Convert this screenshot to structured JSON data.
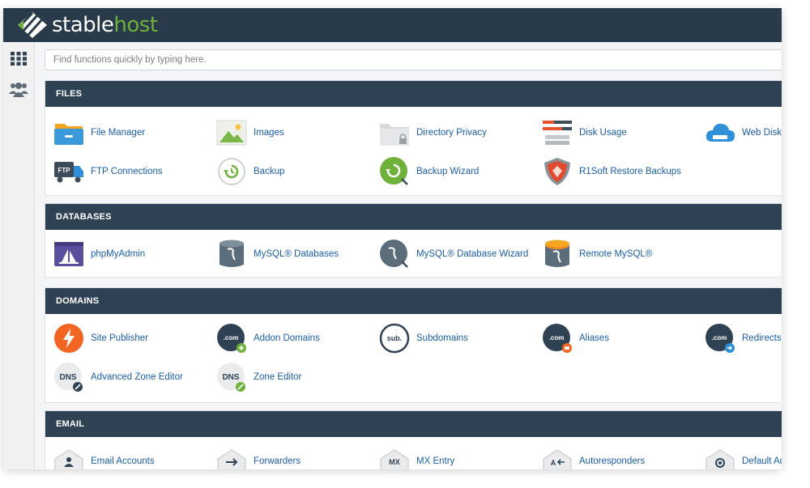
{
  "brand": {
    "part1": "stable",
    "part2": "host"
  },
  "search": {
    "placeholder": "Find functions quickly by typing here."
  },
  "sections": {
    "files": {
      "title": "FILES",
      "items": [
        "File Manager",
        "Images",
        "Directory Privacy",
        "Disk Usage",
        "Web Disk",
        "FTP Connections",
        "Backup",
        "Backup Wizard",
        "R1Soft Restore Backups"
      ]
    },
    "databases": {
      "title": "DATABASES",
      "items": [
        "phpMyAdmin",
        "MySQL® Databases",
        "MySQL® Database Wizard",
        "Remote MySQL®"
      ]
    },
    "domains": {
      "title": "DOMAINS",
      "items": [
        "Site Publisher",
        "Addon Domains",
        "Subdomains",
        "Aliases",
        "Redirects",
        "Advanced Zone Editor",
        "Zone Editor"
      ]
    },
    "email": {
      "title": "EMAIL",
      "items": [
        "Email Accounts",
        "Forwarders",
        "MX Entry",
        "Autoresponders",
        "Default Address"
      ]
    }
  },
  "icon_text": {
    "ftp": "FTP",
    "com": ".com",
    "sub": "sub.",
    "dns": "DNS",
    "mx": "MX",
    "autoresp": "A"
  },
  "colors": {
    "topbar": "#293a4a",
    "section_header": "#2f4253",
    "link": "#1a5ea8",
    "brand_green": "#6fb23b"
  }
}
